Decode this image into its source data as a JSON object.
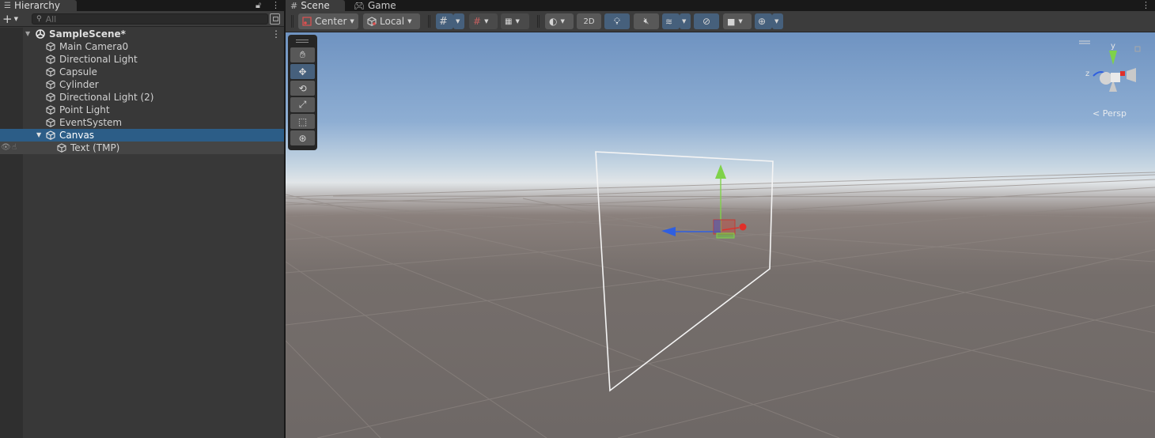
{
  "hierarchy": {
    "tab_label": "Hierarchy",
    "search_placeholder": "All",
    "scene_name": "SampleScene*",
    "items": [
      {
        "label": "Main Camera0"
      },
      {
        "label": "Directional Light"
      },
      {
        "label": "Capsule"
      },
      {
        "label": "Cylinder"
      },
      {
        "label": "Directional Light (2)"
      },
      {
        "label": "Point Light"
      },
      {
        "label": "EventSystem"
      },
      {
        "label": "Canvas",
        "selected": true,
        "expanded": true
      },
      {
        "label": "Text (TMP)",
        "child_of": "Canvas"
      }
    ]
  },
  "scene_view": {
    "tabs": [
      {
        "label": "Scene",
        "active": true,
        "icon": "hash-icon"
      },
      {
        "label": "Game",
        "active": false,
        "icon": "gamepad-icon"
      }
    ],
    "toolbar": {
      "pivot_mode": "Center",
      "pivot_rotation": "Local",
      "mode_2d": "2D"
    },
    "tools": [
      "hand-tool",
      "move-tool",
      "rotate-tool",
      "scale-tool",
      "rect-tool",
      "transform-tool"
    ],
    "active_tool": "move-tool",
    "orientation_gizmo": {
      "axes": [
        "y",
        "z"
      ],
      "label": "< Persp"
    }
  },
  "colors": {
    "selection": "#2c5d87",
    "panel_bg": "#383838",
    "toolbar_bg": "#3c3c3c",
    "button_on": "#46607c",
    "axis_x": "#e0302a",
    "axis_y": "#7fd24a",
    "axis_z": "#2f5fe0"
  }
}
